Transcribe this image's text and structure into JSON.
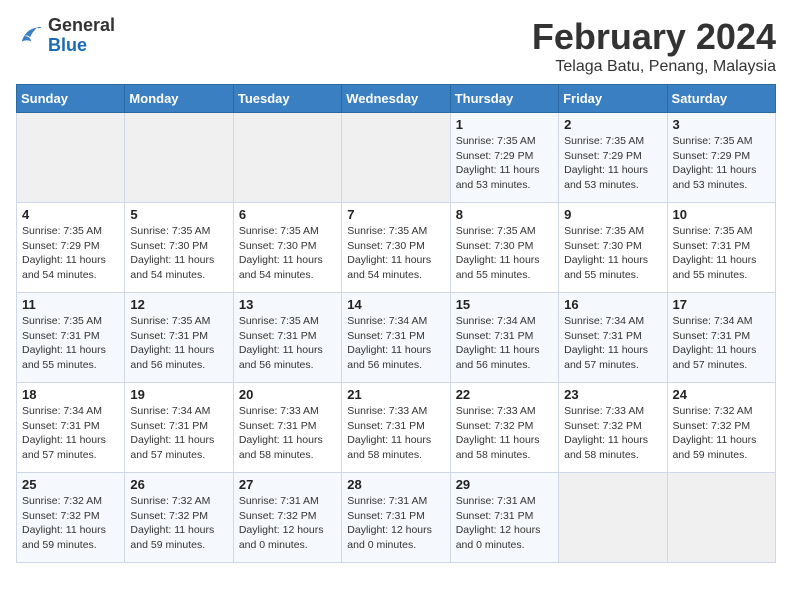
{
  "header": {
    "logo": {
      "general": "General",
      "blue": "Blue"
    },
    "month": "February 2024",
    "location": "Telaga Batu, Penang, Malaysia"
  },
  "weekdays": [
    "Sunday",
    "Monday",
    "Tuesday",
    "Wednesday",
    "Thursday",
    "Friday",
    "Saturday"
  ],
  "weeks": [
    [
      {
        "day": "",
        "info": ""
      },
      {
        "day": "",
        "info": ""
      },
      {
        "day": "",
        "info": ""
      },
      {
        "day": "",
        "info": ""
      },
      {
        "day": "1",
        "info": "Sunrise: 7:35 AM\nSunset: 7:29 PM\nDaylight: 11 hours\nand 53 minutes."
      },
      {
        "day": "2",
        "info": "Sunrise: 7:35 AM\nSunset: 7:29 PM\nDaylight: 11 hours\nand 53 minutes."
      },
      {
        "day": "3",
        "info": "Sunrise: 7:35 AM\nSunset: 7:29 PM\nDaylight: 11 hours\nand 53 minutes."
      }
    ],
    [
      {
        "day": "4",
        "info": "Sunrise: 7:35 AM\nSunset: 7:29 PM\nDaylight: 11 hours\nand 54 minutes."
      },
      {
        "day": "5",
        "info": "Sunrise: 7:35 AM\nSunset: 7:30 PM\nDaylight: 11 hours\nand 54 minutes."
      },
      {
        "day": "6",
        "info": "Sunrise: 7:35 AM\nSunset: 7:30 PM\nDaylight: 11 hours\nand 54 minutes."
      },
      {
        "day": "7",
        "info": "Sunrise: 7:35 AM\nSunset: 7:30 PM\nDaylight: 11 hours\nand 54 minutes."
      },
      {
        "day": "8",
        "info": "Sunrise: 7:35 AM\nSunset: 7:30 PM\nDaylight: 11 hours\nand 55 minutes."
      },
      {
        "day": "9",
        "info": "Sunrise: 7:35 AM\nSunset: 7:30 PM\nDaylight: 11 hours\nand 55 minutes."
      },
      {
        "day": "10",
        "info": "Sunrise: 7:35 AM\nSunset: 7:31 PM\nDaylight: 11 hours\nand 55 minutes."
      }
    ],
    [
      {
        "day": "11",
        "info": "Sunrise: 7:35 AM\nSunset: 7:31 PM\nDaylight: 11 hours\nand 55 minutes."
      },
      {
        "day": "12",
        "info": "Sunrise: 7:35 AM\nSunset: 7:31 PM\nDaylight: 11 hours\nand 56 minutes."
      },
      {
        "day": "13",
        "info": "Sunrise: 7:35 AM\nSunset: 7:31 PM\nDaylight: 11 hours\nand 56 minutes."
      },
      {
        "day": "14",
        "info": "Sunrise: 7:34 AM\nSunset: 7:31 PM\nDaylight: 11 hours\nand 56 minutes."
      },
      {
        "day": "15",
        "info": "Sunrise: 7:34 AM\nSunset: 7:31 PM\nDaylight: 11 hours\nand 56 minutes."
      },
      {
        "day": "16",
        "info": "Sunrise: 7:34 AM\nSunset: 7:31 PM\nDaylight: 11 hours\nand 57 minutes."
      },
      {
        "day": "17",
        "info": "Sunrise: 7:34 AM\nSunset: 7:31 PM\nDaylight: 11 hours\nand 57 minutes."
      }
    ],
    [
      {
        "day": "18",
        "info": "Sunrise: 7:34 AM\nSunset: 7:31 PM\nDaylight: 11 hours\nand 57 minutes."
      },
      {
        "day": "19",
        "info": "Sunrise: 7:34 AM\nSunset: 7:31 PM\nDaylight: 11 hours\nand 57 minutes."
      },
      {
        "day": "20",
        "info": "Sunrise: 7:33 AM\nSunset: 7:31 PM\nDaylight: 11 hours\nand 58 minutes."
      },
      {
        "day": "21",
        "info": "Sunrise: 7:33 AM\nSunset: 7:31 PM\nDaylight: 11 hours\nand 58 minutes."
      },
      {
        "day": "22",
        "info": "Sunrise: 7:33 AM\nSunset: 7:32 PM\nDaylight: 11 hours\nand 58 minutes."
      },
      {
        "day": "23",
        "info": "Sunrise: 7:33 AM\nSunset: 7:32 PM\nDaylight: 11 hours\nand 58 minutes."
      },
      {
        "day": "24",
        "info": "Sunrise: 7:32 AM\nSunset: 7:32 PM\nDaylight: 11 hours\nand 59 minutes."
      }
    ],
    [
      {
        "day": "25",
        "info": "Sunrise: 7:32 AM\nSunset: 7:32 PM\nDaylight: 11 hours\nand 59 minutes."
      },
      {
        "day": "26",
        "info": "Sunrise: 7:32 AM\nSunset: 7:32 PM\nDaylight: 11 hours\nand 59 minutes."
      },
      {
        "day": "27",
        "info": "Sunrise: 7:31 AM\nSunset: 7:32 PM\nDaylight: 12 hours\nand 0 minutes."
      },
      {
        "day": "28",
        "info": "Sunrise: 7:31 AM\nSunset: 7:31 PM\nDaylight: 12 hours\nand 0 minutes."
      },
      {
        "day": "29",
        "info": "Sunrise: 7:31 AM\nSunset: 7:31 PM\nDaylight: 12 hours\nand 0 minutes."
      },
      {
        "day": "",
        "info": ""
      },
      {
        "day": "",
        "info": ""
      }
    ]
  ]
}
